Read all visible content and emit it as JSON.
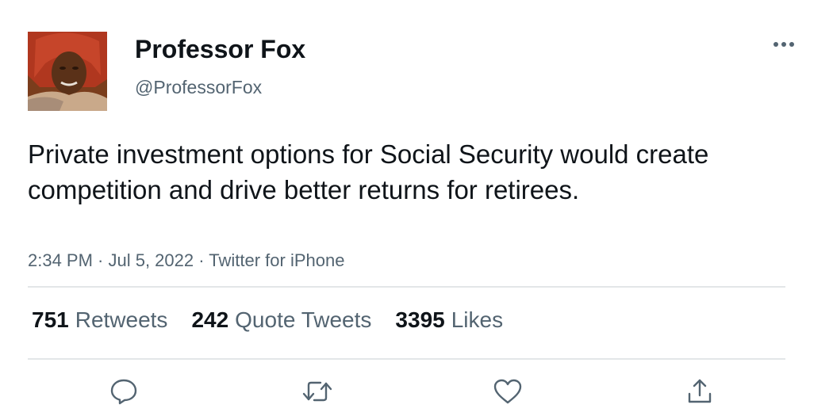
{
  "user": {
    "display_name": "Professor Fox",
    "handle": "@ProfessorFox"
  },
  "tweet": {
    "text": "Private investment options for Social Security would create competition and drive better returns for retirees.",
    "meta": "2:34 PM · Jul 5, 2022 · Twitter for iPhone"
  },
  "stats": {
    "retweets_count": "751",
    "retweets_label": "Retweets",
    "quotes_count": "242",
    "quotes_label": "Quote Tweets",
    "likes_count": "3395",
    "likes_label": "Likes"
  },
  "icons": {
    "more": "more-horizontal-icon",
    "reply": "reply-icon",
    "retweet": "retweet-icon",
    "like": "heart-icon",
    "share": "share-icon"
  },
  "colors": {
    "text_primary": "#0f1419",
    "text_secondary": "#536471",
    "divider": "#e3e6e8",
    "icon": "#536471"
  }
}
